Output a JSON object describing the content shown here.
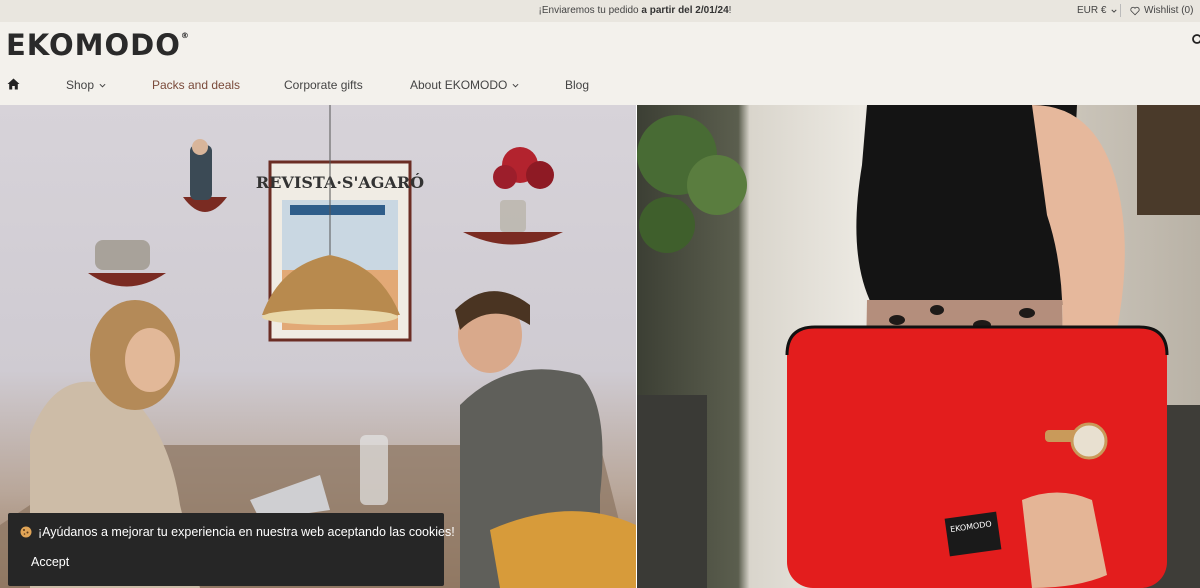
{
  "topbar": {
    "promo_prefix": "¡Enviaremos tu pedido ",
    "promo_bold": "a partir del 2/01/24",
    "promo_suffix": "!",
    "currency": "EUR €",
    "wishlist": "Wishlist (0)"
  },
  "header": {
    "logo": "EKOMODO",
    "logo_mark": "®"
  },
  "nav": {
    "items": [
      {
        "label": "Shop"
      },
      {
        "label": "Packs and deals"
      },
      {
        "label": "Corporate gifts"
      },
      {
        "label": "About EKOMODO"
      },
      {
        "label": "Blog"
      }
    ]
  },
  "hero": {
    "left_alt": "",
    "right_alt": ""
  },
  "cookie": {
    "message": "¡Ayúdanos a mejorar tu experiencia en nuestra web aceptando las cookies!",
    "accept_label": "Accept"
  },
  "colors": {
    "accent": "#7a4a3a",
    "topbar_bg": "#e9e6df",
    "page_bg": "#f3f1ec",
    "cookie_bg": "#262626",
    "sleeve_red": "#e31d1d"
  },
  "icons": [
    "heart-icon",
    "search-icon",
    "home-icon",
    "chevron-down-icon",
    "cookie-icon"
  ]
}
